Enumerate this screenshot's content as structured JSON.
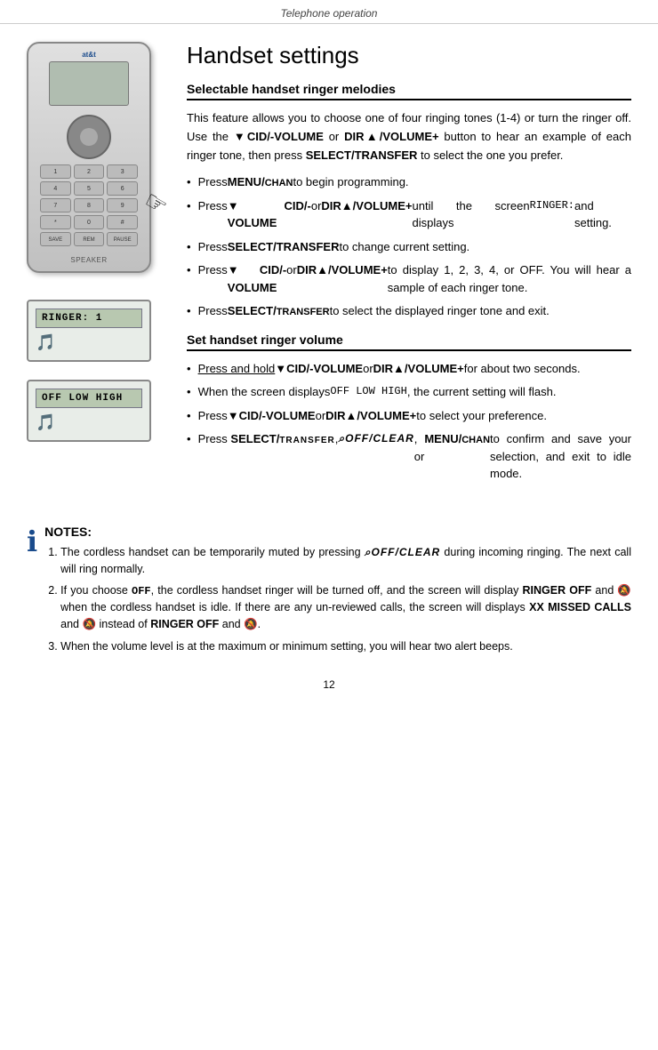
{
  "page": {
    "header": "Telephone operation",
    "footer": "12"
  },
  "title": "Handset settings",
  "sections": [
    {
      "id": "ringer-melodies",
      "title": "Selectable handset ringer melodies",
      "intro": "This feature allows you to choose one of four ringing tones (1-4) or turn the ringer off. Use the ▼CID/-VOLUME or DIR▲/VOLUME+ button to hear an example of each ringer tone, then press SELECT/TRANSFER to select the one you prefer.",
      "bullets": [
        "Press MENU/CHAN to begin programming.",
        "Press ▼CID/-VOLUME or DIR▲/VOLUME+ until the screen displays RINGER: and setting.",
        "Press SELECT/TRANSFER to change current setting.",
        "Press ▼CID/-VOLUME or DIR▲/VOLUME+ to display 1, 2, 3, 4, or OFF. You will hear a sample of each ringer tone.",
        "Press SELECT/TRANSFER to select the displayed ringer tone and exit."
      ]
    },
    {
      "id": "ringer-volume",
      "title": "Set handset ringer volume",
      "bullets": [
        "Press and hold ▼CID/-VOLUME or DIR▲/VOLUME+ for about two seconds.",
        "When the screen displays OFF LOW HIGH, the current setting will flash.",
        "Press ▼CID/-VOLUME or DIR▲/VOLUME+ to select your preference.",
        "Press SELECT/TRANSFER, OFF/CLEAR, or MENU/CHAN to confirm and save your selection, and exit to idle mode."
      ]
    }
  ],
  "notes": {
    "title": "NOTES:",
    "items": [
      "The cordless handset can be temporarily muted by pressing OFF/CLEAR during incoming ringing. The next call will ring normally.",
      "If you choose OFF, the cordless handset ringer will be turned off, and the screen will display RINGER OFF and 🔕 when the cordless handset is idle. If there are any un-reviewed calls, the screen will displays XX MISSED CALLS and 🔕 instead of RINGER OFF and 🔕.",
      "When the volume level is at the maximum or minimum setting, you will hear two alert beeps."
    ]
  },
  "display_boxes": {
    "ringer1": {
      "screen_text": "RINGER: 1"
    },
    "volume": {
      "screen_text": "OFF LOW HIGH"
    }
  }
}
